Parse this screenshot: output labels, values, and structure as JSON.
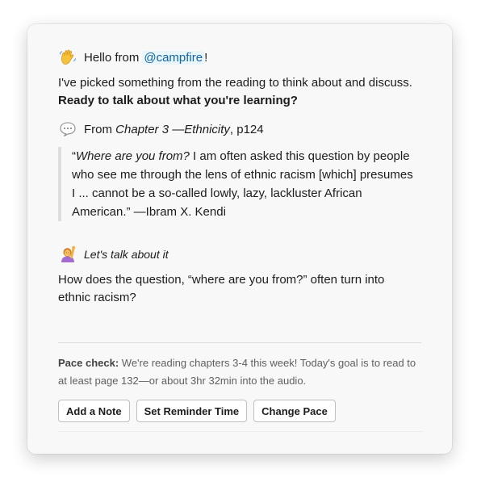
{
  "greeting": {
    "emoji": "waving-hand",
    "prefix": "Hello from",
    "mention": "@campfire",
    "suffix": "!"
  },
  "intro": {
    "line1": "I've picked something from the reading to think about and discuss.",
    "line2": "Ready to talk about what you're learning?"
  },
  "source": {
    "emoji": "speech-balloon",
    "from": "From",
    "chapter": "Chapter 3 —Ethnicity",
    "page": ", p124"
  },
  "quote": {
    "open": "“",
    "italic": "Where are you from?",
    "line1_rest": " I am often asked this question by people",
    "line2": "who see me through the lens of ethnic racism [which] presumes",
    "line3": "I  ... cannot be a so-called lowly, lazy, lackluster African",
    "line4": "American.” —Ibram X. Kendi"
  },
  "talk": {
    "emoji": "person-raising-hand",
    "label": "Let's talk about it"
  },
  "question": {
    "line1": "How does the question, “where are you from?” often turn into",
    "line2": "ethnic racism?"
  },
  "pace": {
    "label": "Pace check:",
    "line1_rest": " We're reading chapters 3-4 this week! Today's goal is to read to",
    "line2": "at least page 132—or about 3hr 32min into the audio."
  },
  "buttons": {
    "add_note": "Add a Note",
    "set_reminder": "Set Reminder Time",
    "change_pace": "Change Pace"
  },
  "colors": {
    "mention": "#1264a3",
    "mention_bg": "#e8f5fa",
    "card_bg": "#f8f8f8",
    "quote_bar": "#dddddd"
  }
}
